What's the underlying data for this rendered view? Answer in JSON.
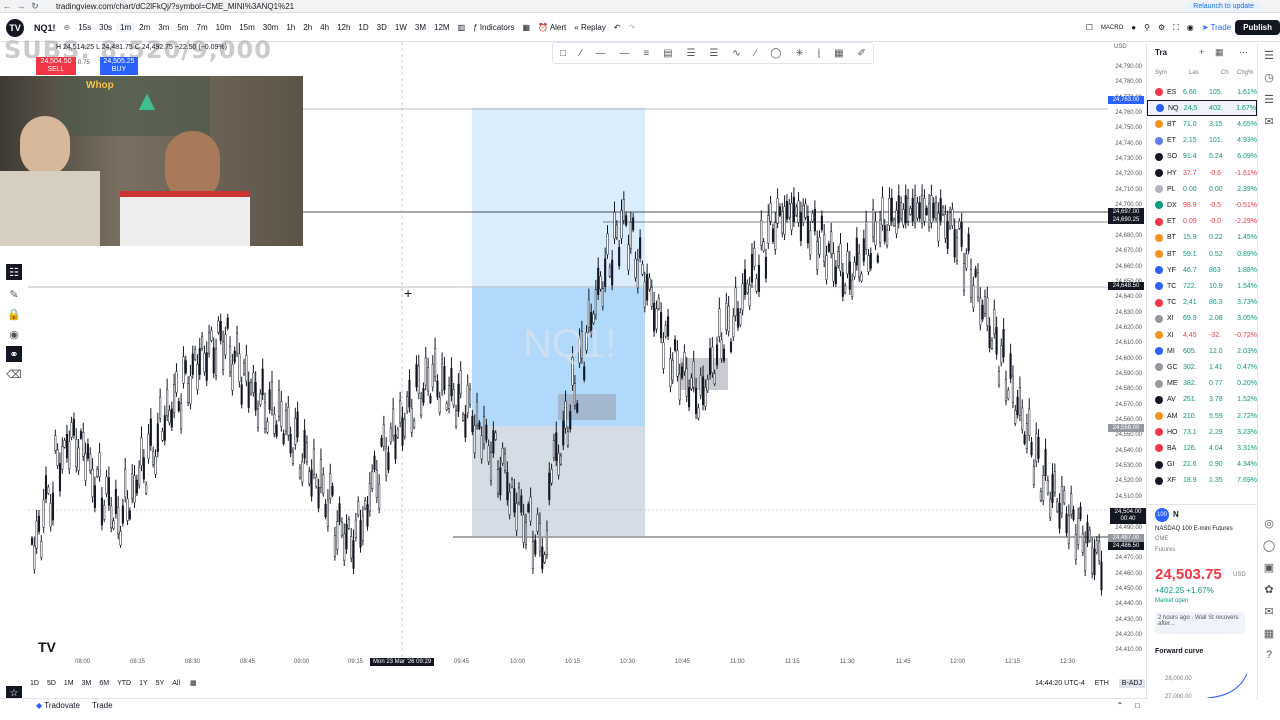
{
  "browser": {
    "url": "tradingview.com/chart/dC2lFkQj/?symbol=CME_MINI%3ANQ1%21",
    "relaunch": "Relaunch to update"
  },
  "toolbar": {
    "symbol": "NQ1!",
    "intervals": [
      "15s",
      "30s",
      "1m",
      "2m",
      "3m",
      "5m",
      "7m",
      "10m",
      "15m",
      "30m",
      "1h",
      "2h",
      "4h",
      "12h",
      "1D",
      "3D",
      "1W",
      "3M",
      "12M"
    ],
    "indicators": "Indicators",
    "alert": "Alert",
    "replay": "Replay",
    "macro": "MACRO",
    "trade": "Trade",
    "publish": "Publish"
  },
  "chart": {
    "ohlc": "H 24,514.25 L 24,481.75 C 24,492.75 −22.50 (−0.09%)",
    "sell_price": "24,504.50",
    "sell_label": "SELL",
    "spread": "0.75",
    "buy_price": "24,505.25",
    "buy_label": "BUY",
    "watermark": "SUBS: 8,520/9,000",
    "webcam_text": "Whop",
    "crosshair_time": "Mon 23 Mar '26   09:29",
    "current_price_tag": "24,504.00",
    "current_time_tag": "00:40"
  },
  "price_axis": {
    "labels": [
      "24,790.00",
      "24,780.00",
      "24,770.00",
      "24,760.00",
      "24,750.00",
      "24,740.00",
      "24,730.00",
      "24,720.00",
      "24,710.00",
      "24,700.00",
      "24,690.00",
      "24,680.00",
      "24,670.00",
      "24,660.00",
      "24,650.00",
      "24,640.00",
      "24,630.00",
      "24,620.00",
      "24,610.00",
      "24,600.00",
      "24,590.00",
      "24,580.00",
      "24,570.00",
      "24,560.00",
      "24,550.00",
      "24,540.00",
      "24,530.00",
      "24,520.00",
      "24,510.00",
      "24,500.00",
      "24,490.00",
      "24,480.00",
      "24,470.00",
      "24,460.00",
      "24,450.00",
      "24,440.00",
      "24,430.00",
      "24,420.00",
      "24,410.00"
    ],
    "tags": [
      {
        "text": "24,763.00",
        "color": "#2962ff"
      },
      {
        "text": "24,697.00",
        "color": "#131722"
      },
      {
        "text": "24,690.25",
        "color": "#131722"
      },
      {
        "text": "24,648.50",
        "color": "#131722"
      },
      {
        "text": "24,558.00",
        "color": "#9598a1"
      },
      {
        "text": "24,487.00",
        "color": "#9598a1"
      },
      {
        "text": "24,486.50",
        "color": "#131722"
      }
    ],
    "currency": "USD"
  },
  "time_axis": [
    "08:00",
    "08:15",
    "08:30",
    "08:45",
    "09:00",
    "09:15",
    "09:45",
    "10:00",
    "10:15",
    "10:30",
    "10:45",
    "11:00",
    "11:15",
    "11:30",
    "11:45",
    "12:00",
    "12:15",
    "12:30"
  ],
  "bottom": {
    "ranges": [
      "1D",
      "5D",
      "1M",
      "3M",
      "6M",
      "YTD",
      "1Y",
      "5Y",
      "All"
    ],
    "clock": "14:44:20 UTC-4",
    "eth": "ETH",
    "badj": "B-ADJ"
  },
  "taskbar": {
    "tradovate": "Tradovate",
    "trade": "Trade"
  },
  "watchlist": {
    "header": "Tra",
    "columns": [
      "Sym",
      "Las",
      "Ch",
      "Chg%"
    ],
    "rows": [
      {
        "sym": "ES",
        "last": "6,66",
        "chg": "105.",
        "pct": "1.61%",
        "color": "#f23645",
        "up": true
      },
      {
        "sym": "NQ",
        "last": "24,5",
        "chg": "402.",
        "pct": "1.67%",
        "color": "#2962ff",
        "up": true
      },
      {
        "sym": "BT",
        "last": "71,0",
        "chg": "3,15",
        "pct": "4.65%",
        "color": "#f7931a",
        "up": true
      },
      {
        "sym": "ET",
        "last": "2,15",
        "chg": "101.",
        "pct": "4.93%",
        "color": "#627eea",
        "up": true
      },
      {
        "sym": "SO",
        "last": "91.4",
        "chg": "5.24",
        "pct": "6.09%",
        "color": "#131722",
        "up": true
      },
      {
        "sym": "HY",
        "last": "37.7",
        "chg": "-0.6",
        "pct": "-1.61%",
        "color": "#131722",
        "up": false
      },
      {
        "sym": "PL",
        "last": "0.00",
        "chg": "0.00",
        "pct": "2.39%",
        "color": "#b2b5be",
        "up": true
      },
      {
        "sym": "DX",
        "last": "98.9",
        "chg": "-0.5",
        "pct": "-0.51%",
        "color": "#089981",
        "up": false
      },
      {
        "sym": "ET",
        "last": "0.09",
        "chg": "-0.0",
        "pct": "-2.29%",
        "color": "#f23645",
        "up": false
      },
      {
        "sym": "BT",
        "last": "15.9",
        "chg": "0.22",
        "pct": "1.45%",
        "color": "#f7931a",
        "up": true
      },
      {
        "sym": "BT",
        "last": "59.1",
        "chg": "0.52",
        "pct": "0.89%",
        "color": "#f7931a",
        "up": true
      },
      {
        "sym": "YF",
        "last": "46.7",
        "chg": "863",
        "pct": "1.88%",
        "color": "#2962ff",
        "up": true
      },
      {
        "sym": "TC",
        "last": "722.",
        "chg": "10.9",
        "pct": "1.54%",
        "color": "#2962ff",
        "up": true
      },
      {
        "sym": "TC",
        "last": "2,41",
        "chg": "86.3",
        "pct": "3.73%",
        "color": "#f23645",
        "up": true
      },
      {
        "sym": "XI",
        "last": "69.9",
        "chg": "2.08",
        "pct": "3.05%",
        "color": "#9598a1",
        "up": true
      },
      {
        "sym": "XI",
        "last": "4,45",
        "chg": "-32.",
        "pct": "-0.72%",
        "color": "#f7931a",
        "up": false
      },
      {
        "sym": "MI",
        "last": "605.",
        "chg": "12.0",
        "pct": "2.03%",
        "color": "#2962ff",
        "up": true
      },
      {
        "sym": "GC",
        "last": "302.",
        "chg": "1.41",
        "pct": "0.47%",
        "color": "#9598a1",
        "up": true
      },
      {
        "sym": "ME",
        "last": "382.",
        "chg": "0.77",
        "pct": "0.20%",
        "color": "#9598a1",
        "up": true
      },
      {
        "sym": "AV",
        "last": "251.",
        "chg": "3.78",
        "pct": "1.52%",
        "color": "#131722",
        "up": true
      },
      {
        "sym": "AM",
        "last": "210.",
        "chg": "5.59",
        "pct": "2.72%",
        "color": "#f7931a",
        "up": true
      },
      {
        "sym": "HO",
        "last": "73.1",
        "chg": "2.29",
        "pct": "3.23%",
        "color": "#f23645",
        "up": true
      },
      {
        "sym": "BA",
        "last": "126.",
        "chg": "4.04",
        "pct": "3.31%",
        "color": "#f23645",
        "up": true
      },
      {
        "sym": "GI",
        "last": "21.6",
        "chg": "0.90",
        "pct": "4.34%",
        "color": "#131722",
        "up": true
      },
      {
        "sym": "XF",
        "last": "18.9",
        "chg": "1.35",
        "pct": "7.69%",
        "color": "#131722",
        "up": true
      }
    ]
  },
  "details": {
    "symbol": "N",
    "name": "NASDAQ 100 E-mini Futures",
    "exchange": "CME",
    "category": "Futures",
    "price": "24,503.75",
    "currency": "USD",
    "change": "+402.25 +1.67%",
    "status": "Market open",
    "news": "2 hours ago · Wall St recovers after...",
    "forward": "Forward curve",
    "forward_value": "28,000.00",
    "forward_value2": "27,000.00"
  }
}
